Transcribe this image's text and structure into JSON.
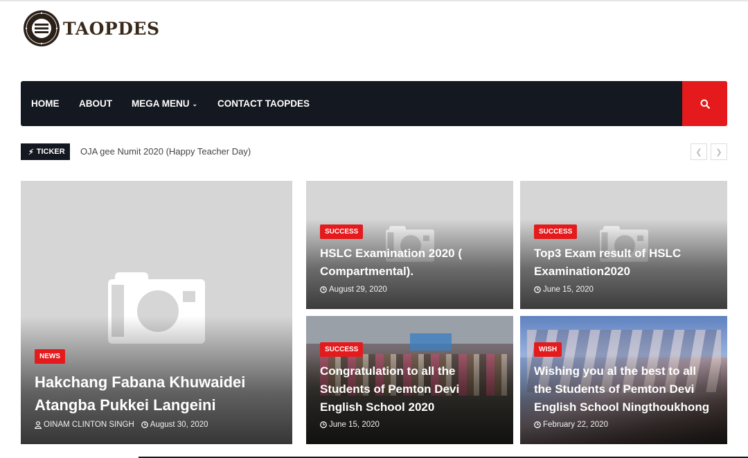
{
  "site": {
    "name": "TAOPDES",
    "logo_seal_text": "READ LEARN SERVE"
  },
  "nav": {
    "items": [
      "HOME",
      "ABOUT",
      "MEGA MENU",
      "CONTACT TAOPDES"
    ],
    "search_icon": "search-icon"
  },
  "ticker": {
    "badge": "TICKER",
    "text": "OJA gee Numit 2020 (Happy Teacher Day)"
  },
  "posts": [
    {
      "label": "NEWS",
      "title_line1": "Hakchang Fabana Khuwaidei",
      "title_line2": "Atangba Pukkei Langeini",
      "author": "OINAM CLINTON SINGH",
      "date": "August 30, 2020"
    },
    {
      "label": "SUCCESS",
      "title_line1": "HSLC Examination 2020 (",
      "title_line2": "Compartmental).",
      "date": "August 29, 2020"
    },
    {
      "label": "SUCCESS",
      "title_line1": "Top3 Exam result of HSLC",
      "title_line2": "Examination2020",
      "date": "June 15, 2020"
    },
    {
      "label": "SUCCESS",
      "title_line1": "Congratulation to all the",
      "title_line2": "Students of Pemton Devi",
      "title_line3": "English School 2020",
      "date": "June 15, 2020"
    },
    {
      "label": "WISH",
      "title_line1": "Wishing you al the best to all",
      "title_line2": "the Students of Pemton Devi",
      "title_line3": "English School Ningthoukhong",
      "date": "February 22, 2020"
    }
  ],
  "colors": {
    "accent": "#e41a1c",
    "nav_bg": "#141820",
    "placeholder_bg": "#d6d6d6"
  }
}
